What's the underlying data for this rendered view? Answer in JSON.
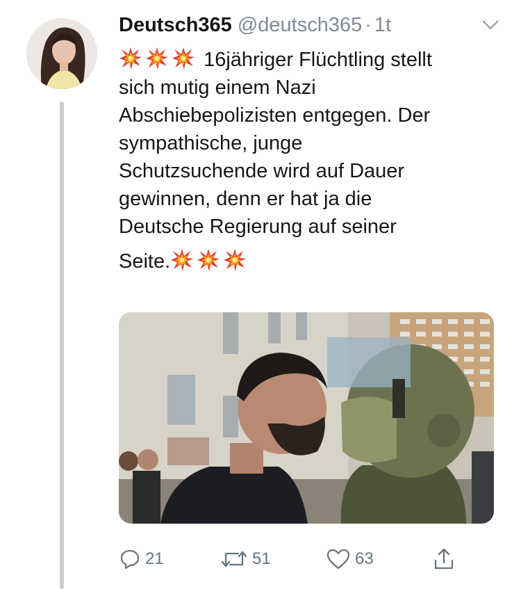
{
  "tweet": {
    "display_name": "Deutsch365",
    "handle": "@deutsch365",
    "separator": "·",
    "time": "1t",
    "lines": [
      "16jähriger Flüchtling stellt",
      "sich mutig einem Nazi",
      "Abschiebepolizisten entgegen. Der",
      "sympathische, junge",
      "Schutzsuchende wird auf Dauer",
      "gewinnen, denn er hat ja die",
      "Deutsche Regierung auf seiner",
      "Seite."
    ],
    "emoji_name": "collision-icon"
  },
  "actions": {
    "replies": "21",
    "retweets": "51",
    "likes": "63"
  },
  "colors": {
    "text": "#14171a",
    "muted": "#7f8a95",
    "thread_line": "#c4ccd4"
  }
}
